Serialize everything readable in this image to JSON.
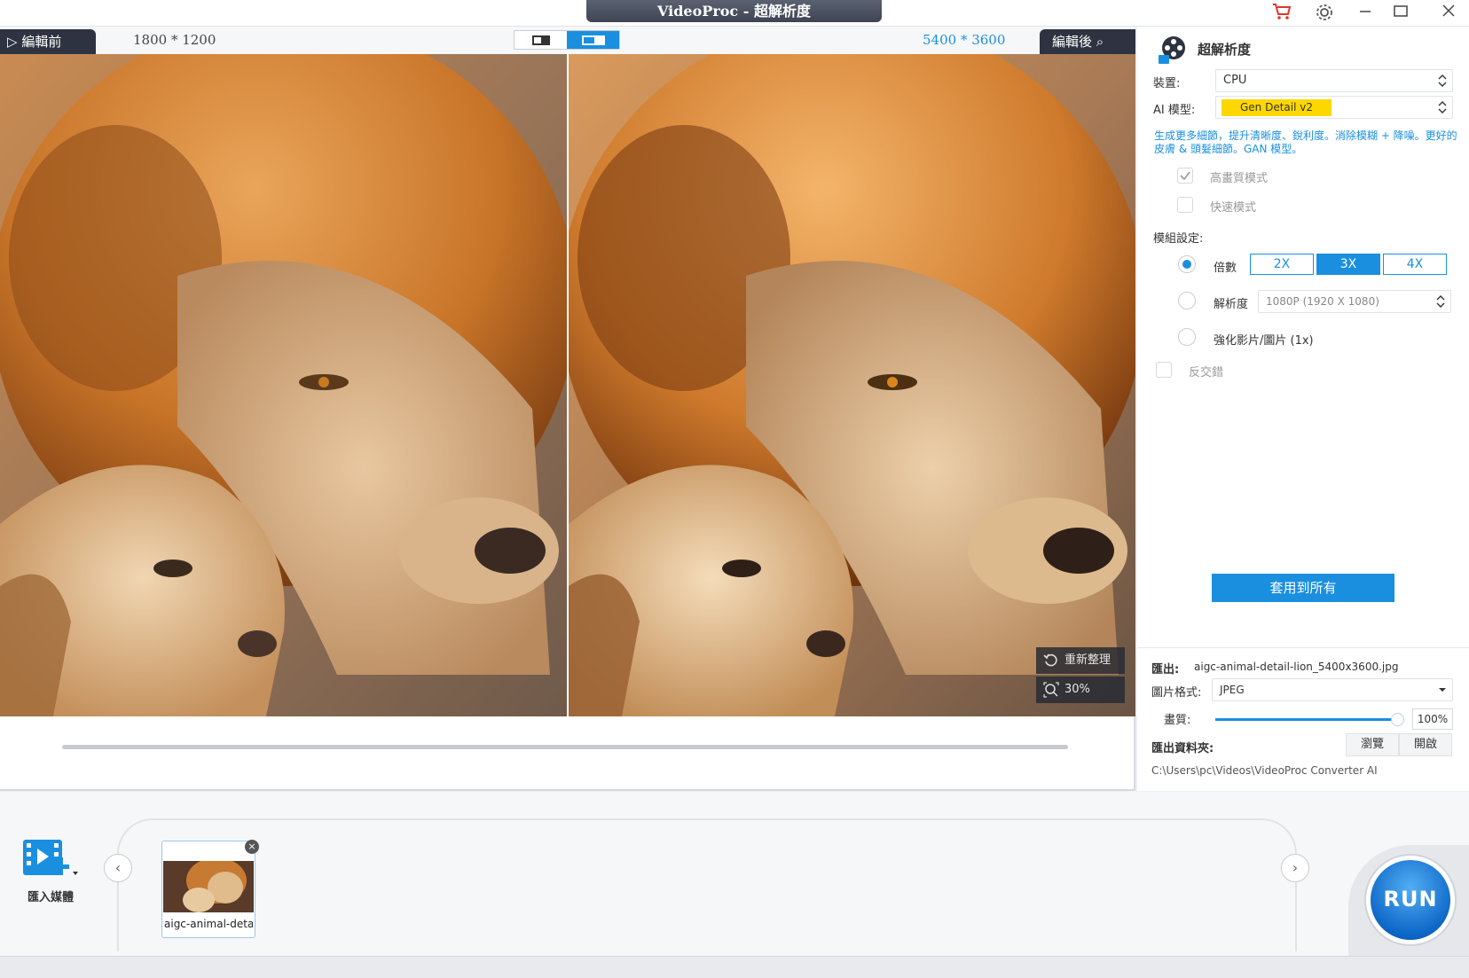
{
  "window": {
    "title": "VideoProc - 超解析度"
  },
  "preview": {
    "before_label": "編輯前",
    "after_label": "編輯後",
    "before_resolution": "1800 * 1200",
    "after_resolution": "5400 * 3600",
    "reset_label": "重新整理",
    "zoom_label": "30%"
  },
  "panel": {
    "title": "超解析度",
    "device_label": "裝置:",
    "device_value": "CPU",
    "model_label": "AI 模型:",
    "model_value": "Gen Detail v2",
    "model_description": "生成更多細節，提升清晰度、銳利度。消除模糊 + 降噪。更好的皮膚 & 頭髮細節。GAN 模型。",
    "high_quality_label": "高畫質模式",
    "fast_mode_label": "快速模式",
    "mode_settings_label": "模組設定:",
    "scale_label": "倍數",
    "scale_options": [
      "2X",
      "3X",
      "4X"
    ],
    "scale_selected": "3X",
    "resolution_label": "解析度",
    "resolution_value": "1080P (1920 X 1080)",
    "enhance_label": "強化影片/圖片 (1x)",
    "deinterlace_label": "反交錯",
    "apply_all_label": "套用到所有"
  },
  "export": {
    "output_label": "匯出:",
    "output_file": "aigc-animal-detail-lion_5400x3600.jpg",
    "format_label": "圖片格式:",
    "format_value": "JPEG",
    "quality_label": "畫質:",
    "quality_value": "100%",
    "quality_fraction": 1.0,
    "folder_label": "匯出資料夾:",
    "browse_label": "瀏覽",
    "open_label": "開啟",
    "folder_path": "C:\\Users\\pc\\Videos\\VideoProc Converter AI"
  },
  "tray": {
    "import_label": "匯入媒體",
    "thumb_label": "aigc-animal-detai",
    "run_label": "RUN"
  },
  "colors": {
    "accent": "#1a8fe0",
    "chip": "#ffd700",
    "dark": "#2d3340"
  }
}
